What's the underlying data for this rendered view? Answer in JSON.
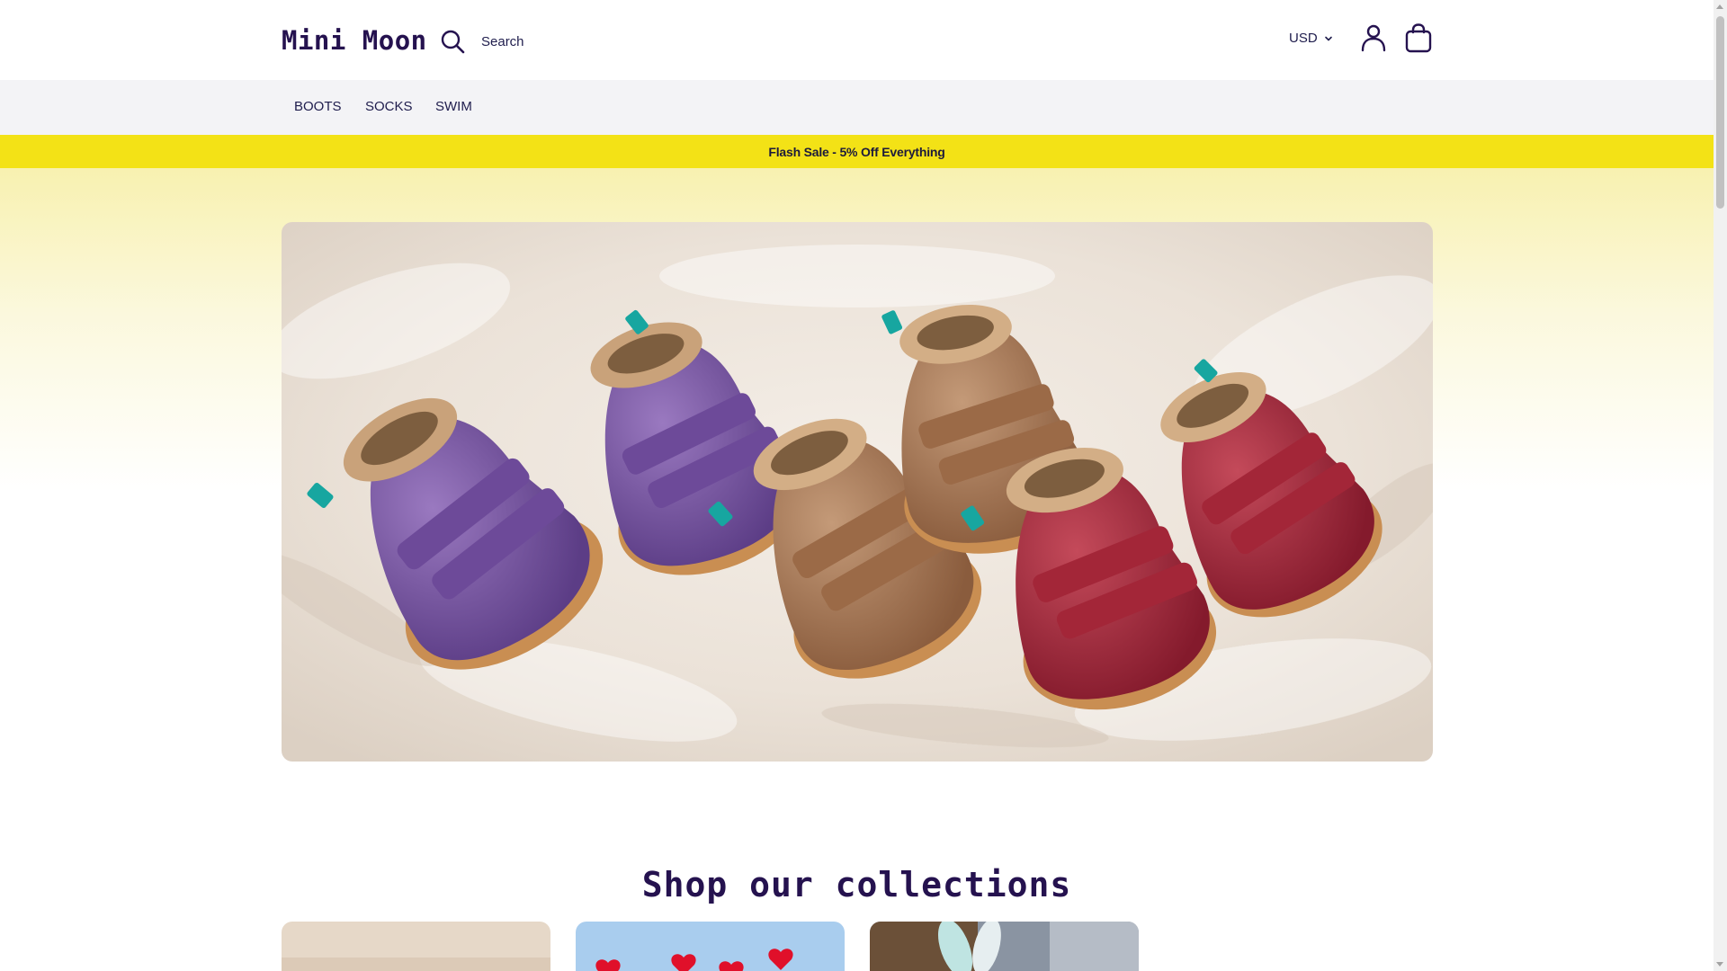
{
  "brand": {
    "logo": "Mini Moon",
    "accent": "#25124f",
    "sale_bar_color": "#f3e216"
  },
  "header": {
    "search_label": "Search",
    "search_icon": "search-icon",
    "currency": "USD",
    "account_icon": "account-icon",
    "cart_icon": "shopping-bag-icon"
  },
  "nav": {
    "items": [
      {
        "label": "BOOTS"
      },
      {
        "label": "SOCKS"
      },
      {
        "label": "SWIM"
      }
    ]
  },
  "announcement": {
    "text": "Flash Sale - 5% Off Everything"
  },
  "collections": {
    "title": "Shop our collections"
  }
}
